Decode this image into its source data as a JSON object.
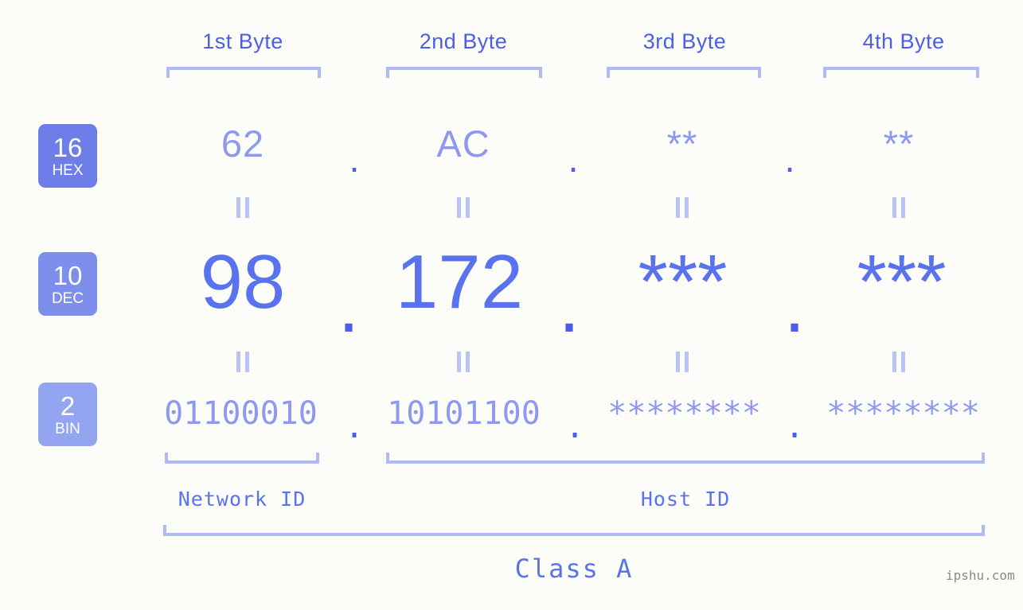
{
  "page": {
    "background_color": "#FCFDF8",
    "accent_color": "#5972EE",
    "accent_light_color": "#8D99EF",
    "bracket_color": "#AFBBF5"
  },
  "columns": [
    {
      "label": "1st Byte"
    },
    {
      "label": "2nd Byte"
    },
    {
      "label": "3rd Byte"
    },
    {
      "label": "4th Byte"
    }
  ],
  "rows": [
    {
      "badge": {
        "number": "16",
        "name": "HEX",
        "color": "#6E7EE8"
      },
      "values": [
        "62",
        "AC",
        "**",
        "**"
      ],
      "separator": "."
    },
    {
      "badge": {
        "number": "10",
        "name": "DEC",
        "color": "#7E8EEC"
      },
      "values": [
        "98",
        "172",
        "***",
        "***"
      ],
      "separator": "."
    },
    {
      "badge": {
        "number": "2",
        "name": "BIN",
        "color": "#93A5F0"
      },
      "values": [
        "01100010",
        "10101100",
        "********",
        "********"
      ],
      "separator": "."
    }
  ],
  "connectors": {
    "symbol": "="
  },
  "id_sections": [
    {
      "label": "Network ID"
    },
    {
      "label": "Host ID"
    }
  ],
  "class_section": {
    "label": "Class A"
  },
  "watermark": {
    "text": "ipshu.com"
  }
}
